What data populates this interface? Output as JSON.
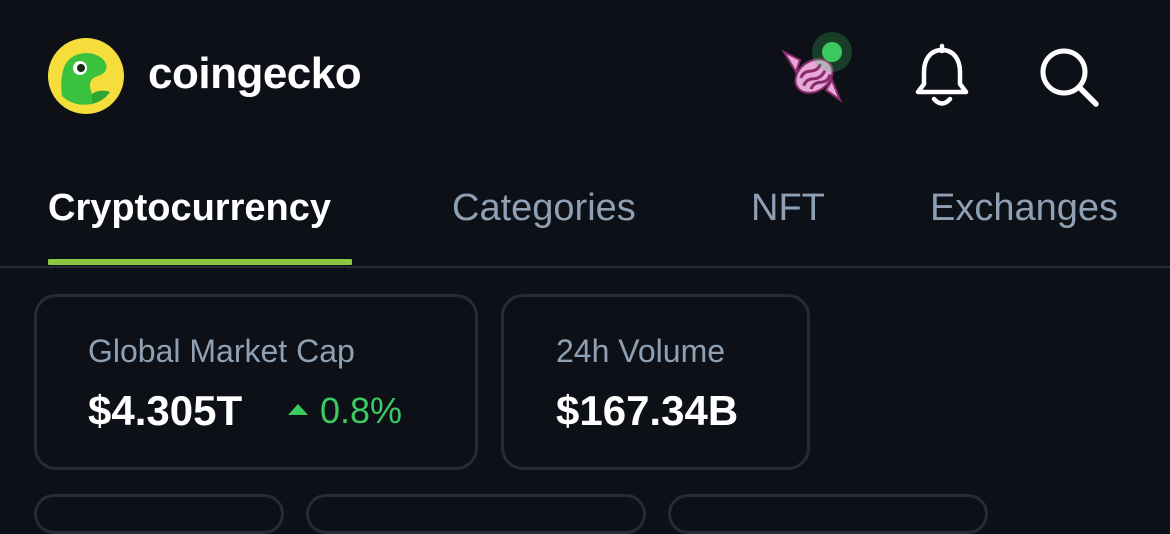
{
  "header": {
    "brand_name": "coingecko",
    "logo_icon": "coingecko-gecko-logo",
    "candy_icon": "candy-icon",
    "notification_icon": "bell-icon",
    "search_icon": "search-icon",
    "candy_badge_color": "#3cc961"
  },
  "tabs": [
    {
      "label": "Cryptocurrency",
      "active": true
    },
    {
      "label": "Categories",
      "active": false
    },
    {
      "label": "NFT",
      "active": false
    },
    {
      "label": "Exchanges",
      "active": false
    }
  ],
  "stats": {
    "market_cap": {
      "label": "Global Market Cap",
      "value": "$4.305T",
      "change": "0.8%",
      "direction": "up"
    },
    "volume": {
      "label": "24h Volume",
      "value": "$167.34B"
    }
  },
  "colors": {
    "background": "#0d1117",
    "accent": "#8dc63f",
    "positive": "#3cc961",
    "muted_text": "#8fa0b4",
    "border": "#262c36"
  }
}
